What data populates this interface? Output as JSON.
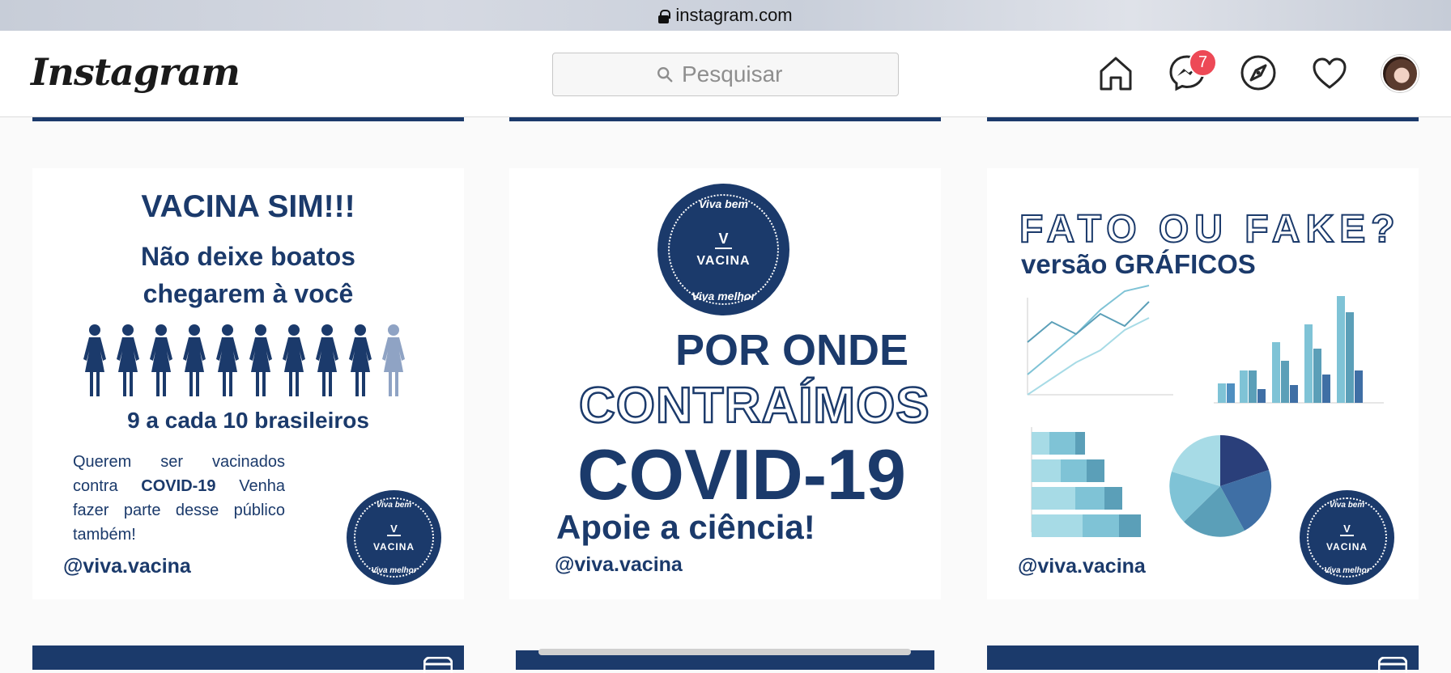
{
  "browser": {
    "url": "instagram.com"
  },
  "header": {
    "logo": "Instagram",
    "search_placeholder": "Pesquisar",
    "messages_badge": "7"
  },
  "posts": [
    {
      "title": "VACINA SIM!!!",
      "subtitle_line1": "Não deixe boatos",
      "subtitle_line2": "chegarem à você",
      "stat": "9 a cada 10 brasileiros",
      "body_pre": "Querem ser vacinados contra ",
      "body_bold": "COVID-19",
      "body_post": " Venha fazer parte desse público também!",
      "handle": "@viva.vacina",
      "figures_total": 10,
      "figures_filled": 9
    },
    {
      "line1": "POR ONDE",
      "line2": "CONTRAÍMOS",
      "line3": "COVID-19",
      "line4": "Apoie a ciência!",
      "handle": "@viva.vacina"
    },
    {
      "title": "FATO OU FAKE?",
      "subtitle": "versão GRÁFICOS",
      "handle": "@viva.vacina"
    }
  ],
  "seal": {
    "top": "Viva bem",
    "letter": "V",
    "word": "VACINA",
    "bottom": "Viva melhor"
  },
  "colors": {
    "navy": "#1b3a6b",
    "badge": "#ed4956",
    "light_figure": "#8fa3c4"
  }
}
